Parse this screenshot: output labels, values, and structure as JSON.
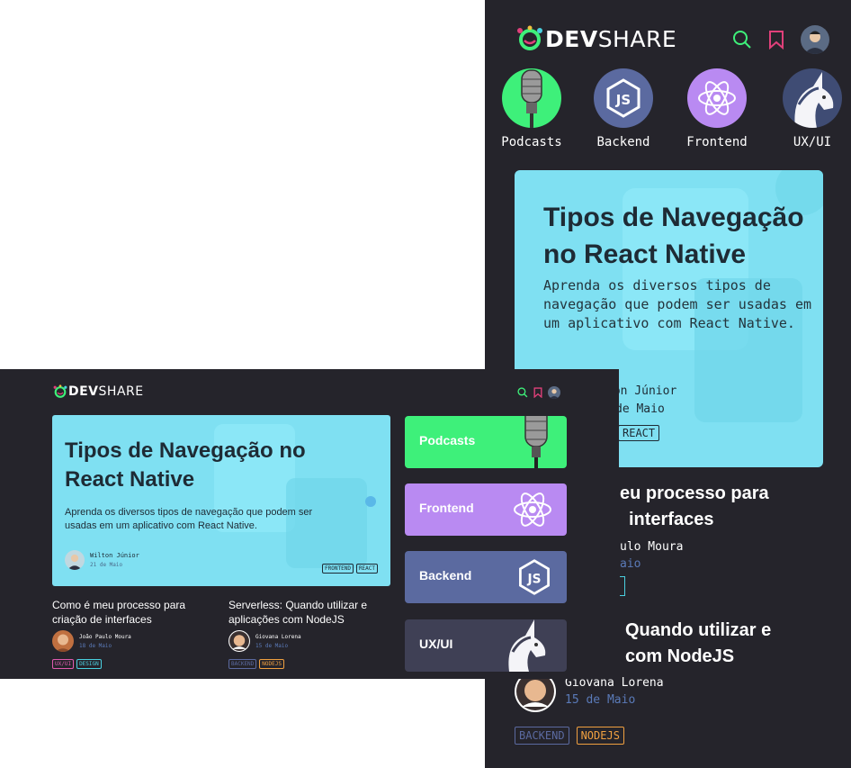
{
  "brand": {
    "dev": "DEV",
    "share": "SHARE"
  },
  "categories": [
    {
      "label": "Podcasts",
      "color": "#3ef07a"
    },
    {
      "label": "Backend",
      "color": "#5b6aa0"
    },
    {
      "label": "Frontend",
      "color": "#b98af2"
    },
    {
      "label": "UX/UI",
      "color": "#3f4c74"
    }
  ],
  "desktop_categories": [
    {
      "label": "Podcasts",
      "color": "#3ef07a"
    },
    {
      "label": "Frontend",
      "color": "#b98af2"
    },
    {
      "label": "Backend",
      "color": "#5b6aa0"
    },
    {
      "label": "UX/UI",
      "color": "#3f4055"
    }
  ],
  "hero": {
    "title": "Tipos de Navegação no React Native",
    "description": "Aprenda os diversos tipos de navegação que podem ser usadas em um aplicativo com React Native.",
    "author": "Wilton Júnior",
    "date": "21 de Maio",
    "tags": [
      "FRONTEND",
      "REACT"
    ],
    "mobile_author_partial": "ton Júnior",
    "mobile_date_partial": "de Maio"
  },
  "posts": [
    {
      "title": "Como é meu processo para criação de interfaces",
      "author": "João Paulo Moura",
      "date": "18 de Maio",
      "tags": [
        {
          "label": "UX/UI",
          "color": "#e05ab0"
        },
        {
          "label": "DESIGN",
          "color": "#4ad0e0"
        }
      ]
    },
    {
      "title": "Serverless: Quando utilizar e aplicações com NodeJS",
      "author": "Giovana Lorena",
      "date": "15 de Maio",
      "tags": [
        {
          "label": "BACKEND",
          "color": "#5b6aa0"
        },
        {
          "label": "NODEJS",
          "color": "#f0a040"
        }
      ]
    }
  ],
  "mobile_fragments": {
    "post1_title_line1": "eu processo para",
    "post1_title_line2": "interfaces",
    "post1_author": "ulo Moura",
    "post1_date": "aio",
    "post2_title_line1": "Quando utilizar e",
    "post2_title_line2": "com NodeJS"
  },
  "icons": {
    "search": "search-icon",
    "bookmark": "bookmark-icon",
    "avatar": "avatar"
  },
  "colors": {
    "bg": "#25242b",
    "accent_green": "#3ef07a",
    "hero_bg": "#7fe0f2",
    "bookmark": "#e0407a"
  }
}
